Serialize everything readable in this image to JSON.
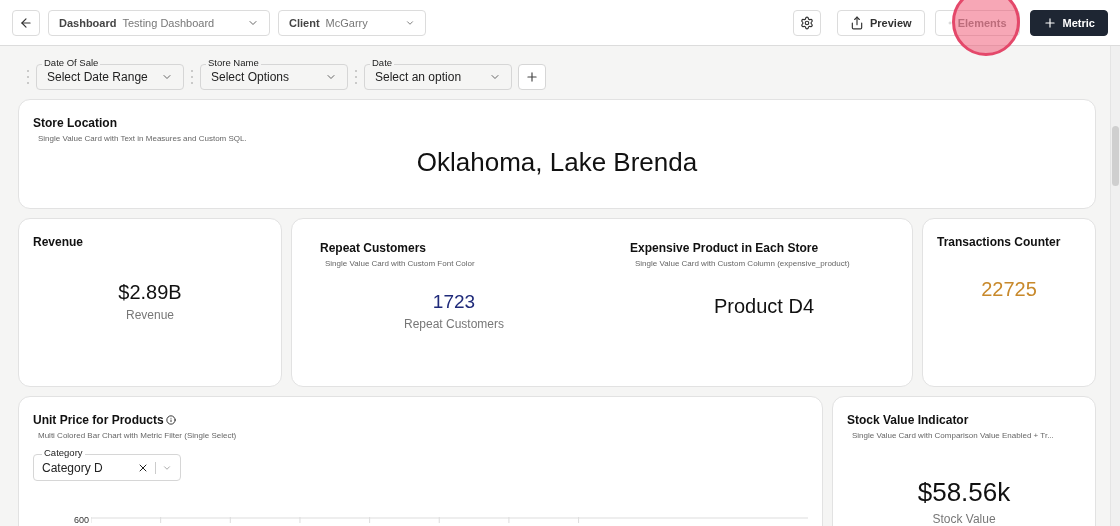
{
  "topbar": {
    "dashboard": {
      "label": "Dashboard",
      "value": "Testing Dashboard"
    },
    "client": {
      "label": "Client",
      "value": "McGarry"
    },
    "buttons": [
      {
        "kind": "settings"
      },
      {
        "kind": "preview",
        "label": "Preview"
      },
      {
        "kind": "elements",
        "label": "Elements",
        "highlighted": true
      },
      {
        "kind": "metric",
        "label": "Metric"
      }
    ]
  },
  "filters": [
    {
      "label": "Date Of Sale",
      "value": "Select Date Range"
    },
    {
      "label": "Store Name",
      "value": "Select Options"
    },
    {
      "label": "Date",
      "value": "Select an option"
    }
  ],
  "rows": [
    [
      {
        "kind": "single",
        "title": "Store Location",
        "subtitle": "Single Value Card with Text in Measures and Custom SQL.",
        "value": "Oklahoma, Lake Brenda"
      }
    ],
    [
      {
        "kind": "single",
        "title": "Revenue",
        "value": "$2.89B",
        "value_label": "Revenue"
      },
      {
        "kind": "group",
        "sections": [
          {
            "title": "Repeat Customers",
            "subtitle": "Single Value Card with Custom Font Color",
            "value": "1723",
            "value_label": "Repeat Customers",
            "color": "#1f2a7a"
          },
          {
            "title": "Expensive Product in Each Store",
            "subtitle": "Single Value Card with Custom Column (expensive_product)",
            "value": "Product D4"
          }
        ]
      },
      {
        "kind": "single",
        "title": "Transactions Counter",
        "value": "22725",
        "color": "#c8892b"
      }
    ],
    [
      {
        "kind": "chart",
        "title": "Unit Price for Products",
        "subtitle": "Multi Colored Bar Chart with Metric Filter (Single Select)",
        "filter": {
          "label": "Category",
          "value": "Category D"
        },
        "top_tick": "600"
      },
      {
        "kind": "single",
        "title": "Stock Value Indicator",
        "subtitle": "Single Value Card with Comparison Value Enabled + Tr...",
        "value": "$58.56k",
        "value_label": "Stock Value"
      }
    ]
  ]
}
